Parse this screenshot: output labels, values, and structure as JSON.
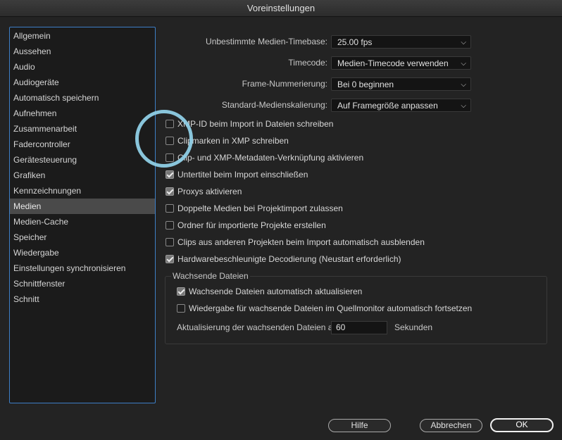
{
  "window": {
    "title": "Voreinstellungen"
  },
  "sidebar": {
    "items": [
      {
        "label": "Allgemein"
      },
      {
        "label": "Aussehen"
      },
      {
        "label": "Audio"
      },
      {
        "label": "Audiogeräte"
      },
      {
        "label": "Automatisch speichern"
      },
      {
        "label": "Aufnehmen"
      },
      {
        "label": "Zusammenarbeit"
      },
      {
        "label": "Fadercontroller"
      },
      {
        "label": "Gerätesteuerung"
      },
      {
        "label": "Grafiken"
      },
      {
        "label": "Kennzeichnungen"
      },
      {
        "label": "Medien",
        "selected": true
      },
      {
        "label": "Medien-Cache"
      },
      {
        "label": "Speicher"
      },
      {
        "label": "Wiedergabe"
      },
      {
        "label": "Einstellungen synchronisieren"
      },
      {
        "label": "Schnittfenster"
      },
      {
        "label": "Schnitt"
      }
    ]
  },
  "settings": {
    "timebase": {
      "label": "Unbestimmte Medien-Timebase:",
      "value": "25.00 fps"
    },
    "timecode": {
      "label": "Timecode:",
      "value": "Medien-Timecode verwenden"
    },
    "frame_numbering": {
      "label": "Frame-Nummerierung:",
      "value": "Bei 0 beginnen"
    },
    "scaling": {
      "label": "Standard-Medienskalierung:",
      "value": "Auf Framegröße anpassen"
    }
  },
  "checkboxes": [
    {
      "label": "XMP-ID beim Import in Dateien schreiben",
      "checked": false
    },
    {
      "label": "Clipmarken in XMP schreiben",
      "checked": false
    },
    {
      "label": "Clip- und XMP-Metadaten-Verknüpfung aktivieren",
      "checked": false
    },
    {
      "label": "Untertitel beim Import einschließen",
      "checked": true
    },
    {
      "label": "Proxys aktivieren",
      "checked": true
    },
    {
      "label": "Doppelte Medien bei Projektimport zulassen",
      "checked": false
    },
    {
      "label": "Ordner für importierte Projekte erstellen",
      "checked": false
    },
    {
      "label": "Clips aus anderen Projekten beim Import automatisch ausblenden",
      "checked": false
    },
    {
      "label": "Hardwarebeschleunigte Decodierung (Neustart erforderlich)",
      "checked": true
    }
  ],
  "growing_files": {
    "title": "Wachsende Dateien",
    "auto_refresh": {
      "label": "Wachsende Dateien automatisch aktualisieren",
      "checked": true
    },
    "auto_continue": {
      "label": "Wiedergabe für wachsende Dateien im Quellmonitor automatisch fortsetzen",
      "checked": false
    },
    "refresh_label": "Aktualisierung der wachsenden Dateien alle",
    "refresh_value": "60",
    "refresh_unit": "Sekunden"
  },
  "buttons": {
    "help": "Hilfe",
    "cancel": "Abbrechen",
    "ok": "OK"
  },
  "icons": {
    "dropdown": "chevron-down-icon",
    "highlight": "highlight-circle"
  }
}
